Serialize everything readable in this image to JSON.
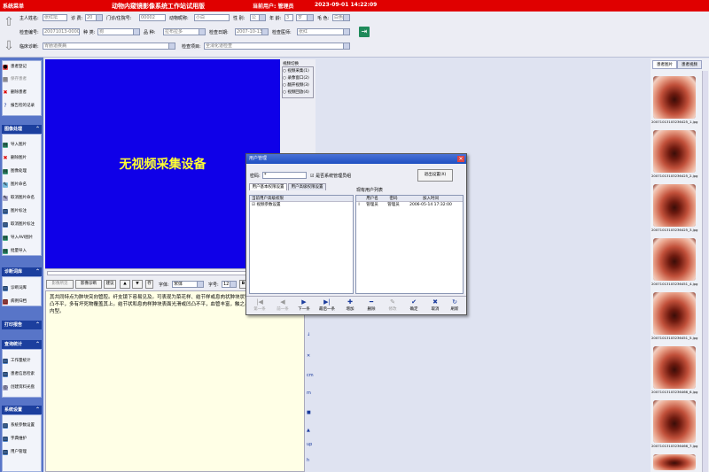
{
  "titlebar": {
    "left": "系统菜单",
    "title": "动物内窥镜影像系统工作站试用版",
    "user": "当前用户: 管理员",
    "datetime": "2023-09-01 14:22:09"
  },
  "form": {
    "owner_label": "主人姓名:",
    "owner_value": "张红坛",
    "diagnosis_label": "诊 费:",
    "diagnosis_value": "20",
    "clinic_label": "门诊/住院号:",
    "clinic_value": "00002",
    "animal_label": "动物昵称:",
    "animal_value": "小白",
    "sex_label": "性 别:",
    "sex_value": "公",
    "age_label": "年 龄:",
    "age_value": "3",
    "age_unit": "岁",
    "color_label": "毛 色:",
    "color_value": "白色",
    "check_no_label": "检查编号:",
    "check_no_value": "20071013-000001",
    "species_label": "种 类:",
    "species_value": "狗",
    "breed_label": "品 种:",
    "breed_value": "拉布拉多",
    "date_label": "检查日期:",
    "date_value": "2007-10-13",
    "doctor_label": "检查医师:",
    "doctor_value": "张红",
    "clinical_label": "临床诊断:",
    "clinical_value": "胃肠道疾病",
    "item_label": "检查项目:",
    "item_value": "全消化道检查"
  },
  "sidebar": {
    "group1_items": [
      "患者登记",
      "保存患者",
      "删除患者",
      "报告检的记录"
    ],
    "group2_title": "图像处理",
    "group2_items": [
      "导入图片",
      "删除图片",
      "图像处理",
      "图片命名",
      "取消图片命名",
      "图片标注",
      "取消图片标注",
      "导入AVI图片",
      "批量导入"
    ],
    "group3_title": "诊断词库",
    "group3_items": [
      "诊断词库",
      "病例归档"
    ],
    "group4_title": "打印报告",
    "group5_title": "查询统计",
    "group5_items": [
      "工作量统计",
      "患者信息检索",
      "创建资料光盘"
    ],
    "group6_title": "系统设置",
    "group6_items": [
      "系统参数设置",
      "字典维护",
      "用户管理"
    ]
  },
  "video": {
    "no_device": "无视频采集设备"
  },
  "video_panel": {
    "title": "视频切换",
    "options": [
      "视频采集(1)",
      "录像窗口(2)",
      "翻开视频(3)",
      "视频回放(4)"
    ]
  },
  "editor": {
    "buttons": [
      "影像所见",
      "影像诊断",
      "建议"
    ],
    "font_label": "字体:",
    "font_value": "宋体",
    "size_label": "字号:",
    "size_value": "12",
    "text": "其共同特点为肿块突向管腔。纤支镜下容易见及。可表现为菜花样、结节样或息肉状肿块状等。菜花样肿块表面多凹凸不平，多有坏死物覆盖其上。结节状和息肉样肿块表面光滑或凹凸不平，血管丰富，触之易出血。肿块型大多属管内型。"
  },
  "ruler_marks": [
    "ℹ",
    "↑",
    "↓",
    "✕",
    "cm",
    "m",
    "■",
    "▲",
    "up",
    "h"
  ],
  "right_panel": {
    "tabs": [
      "患者图片",
      "患者视频"
    ],
    "thumbs": [
      "20071013103236425_1.jpg",
      "20071013103236425_2.jpg",
      "20071013103236425_3.jpg",
      "20071013103236451_4.jpg",
      "20071013103236451_5.jpg",
      "20071013103236466_6.jpg",
      "20071013103236466_7.jpg",
      "20071013103236466_8.jpg"
    ]
  },
  "dialog": {
    "title": "用户管理",
    "password_label": "密码:",
    "password_value": "*",
    "checkbox_label": "是否系统管理员组",
    "exit_button": "退出设置(X)",
    "tab_basic": "用户基本权限设置",
    "tab_advanced": "用户高级权限设置",
    "tree_header": "当前用户高级权限",
    "tree_item": "视频参数设置",
    "list_title": "现有用户列表",
    "columns": [
      "用户名",
      "密码",
      "加入时间"
    ],
    "rows": [
      [
        "管理员",
        "管理员",
        "2006-05-14 17:32:00"
      ]
    ],
    "toolbar": [
      "第一条",
      "前一条",
      "下一条",
      "最后一条",
      "增加",
      "删除",
      "修改",
      "确定",
      "取消",
      "刷新"
    ],
    "toolbar_icons": [
      "|◀",
      "◀",
      "▶",
      "▶|",
      "✚",
      "━",
      "✎",
      "✔",
      "✖",
      "↻"
    ]
  },
  "colors": {
    "titlebar": "#e00000",
    "sidebar": "#5875c8",
    "sidebar_head": "#1c3f9e",
    "video_bg": "#0f00e8",
    "video_text": "#ffff33",
    "editor_bg": "#ffffe6"
  }
}
